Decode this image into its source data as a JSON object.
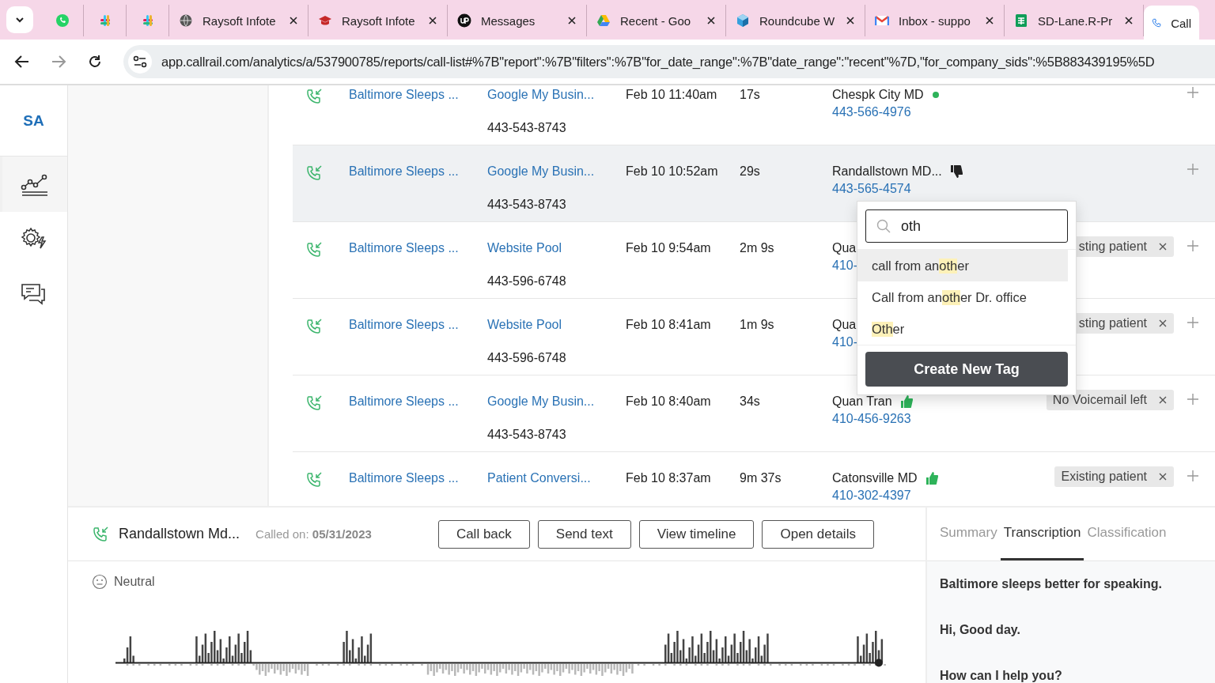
{
  "browser": {
    "tabs": [
      {
        "selected": false
      },
      {
        "selected": false
      },
      {
        "selected": false
      },
      {
        "title": "Raysoft Infote",
        "selected": false
      },
      {
        "title": "Raysoft Infote",
        "selected": false
      },
      {
        "title": "Messages",
        "selected": false
      },
      {
        "title": "Recent - Goo",
        "selected": false
      },
      {
        "title": "Roundcube W",
        "selected": false
      },
      {
        "title": "Inbox - suppo",
        "selected": false
      },
      {
        "title": "SD-Lane.R-Pr",
        "selected": false
      },
      {
        "title": "Call",
        "selected": true
      }
    ],
    "url": "app.callrail.com/analytics/a/537900785/reports/call-list#%7B\"report\":%7B\"filters\":%7B\"for_date_range\":%7B\"date_range\":\"recent\"%7D,\"for_company_sids\":%5B883439195%5D"
  },
  "sidebar": {
    "avatar": "SA",
    "items": [
      {
        "selected": true
      },
      {
        "selected": false
      },
      {
        "selected": false
      }
    ]
  },
  "calls": [
    {
      "selected": false,
      "company": "Baltimore Sleeps ...",
      "source": "Google My Busin...",
      "tracking_number": "443-543-8743",
      "date": "Feb 10 11:40am",
      "duration": "17s",
      "customer": "Chespk City MD",
      "phone": "443-566-4976",
      "rating_mark": {
        "kind": "dot"
      }
    },
    {
      "selected": true,
      "company": "Baltimore Sleeps ...",
      "source": "Google My Busin...",
      "tracking_number": "443-543-8743",
      "date": "Feb 10 10:52am",
      "duration": "29s",
      "customer": "Randallstown MD...",
      "phone": "443-565-4574",
      "rating_mark": {
        "kind": "thumbs-down"
      }
    },
    {
      "selected": false,
      "company": "Baltimore Sleeps ...",
      "source": "Website Pool",
      "tracking_number": "443-596-6748",
      "date": "Feb 10 9:54am",
      "duration": "2m 9s",
      "customer": "Qua",
      "phone": "410-",
      "tags": [
        "sting patient"
      ]
    },
    {
      "selected": false,
      "company": "Baltimore Sleeps ...",
      "source": "Website Pool",
      "tracking_number": "443-596-6748",
      "date": "Feb 10 8:41am",
      "duration": "1m 9s",
      "customer": "Qua",
      "phone": "410-",
      "tags": [
        "sting patient"
      ]
    },
    {
      "selected": false,
      "company": "Baltimore Sleeps ...",
      "source": "Google My Busin...",
      "tracking_number": "443-543-8743",
      "date": "Feb 10 8:40am",
      "duration": "34s",
      "customer": "Quan Tran",
      "phone": "410-456-9263",
      "rating_mark": {
        "kind": "thumbs-up"
      },
      "tags": [
        "No Voicemail left"
      ]
    },
    {
      "selected": false,
      "company": "Baltimore Sleeps ...",
      "source": "Patient Conversi...",
      "date": "Feb 10 8:37am",
      "duration": "9m 37s",
      "customer": "Catonsville MD",
      "phone": "410-302-4397",
      "rating_mark": {
        "kind": "thumbs-up"
      },
      "tags": [
        "Existing patient"
      ]
    }
  ],
  "tag_picker": {
    "search": {
      "value": "oth"
    },
    "options": [
      {
        "before": "call from an",
        "match": "oth",
        "after": "er",
        "highlighted": true
      },
      {
        "before": "Call from an",
        "match": "oth",
        "after": "er Dr. office",
        "highlighted": false
      },
      {
        "match": "Oth",
        "after": "er",
        "highlighted": false
      }
    ],
    "button": "Create New Tag"
  },
  "call_detail": {
    "caller": "Randallstown Md...",
    "called_on": "Called on: **05/31/2023**",
    "buttons": [
      "Call back",
      "Send text",
      "View timeline",
      "Open details"
    ],
    "sentiment": "Neutral"
  },
  "detail_tabs": [
    {
      "label": "Summary",
      "selected": false
    },
    {
      "label": "Transcription",
      "selected": true
    },
    {
      "label": "Classification",
      "selected": false
    }
  ],
  "transcript": [
    "Baltimore sleeps better for speaking.",
    "Hi, Good day.",
    "How can I help you?"
  ]
}
